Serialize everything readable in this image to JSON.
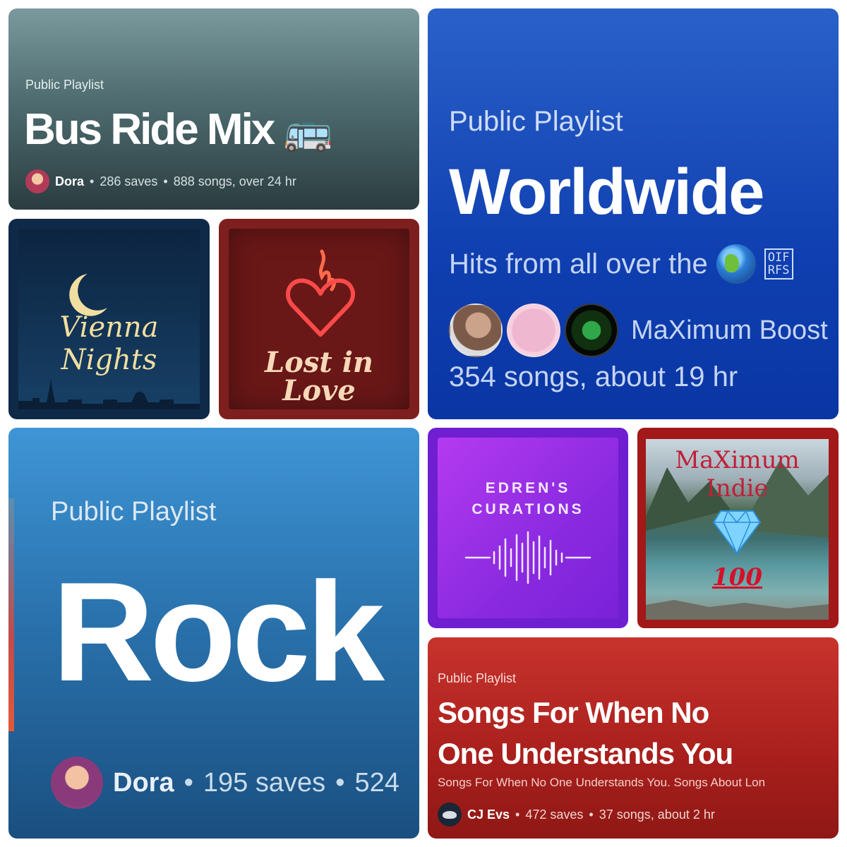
{
  "tiles": {
    "bus": {
      "label": "Public Playlist",
      "title": "Bus Ride Mix",
      "emoji": "🚌",
      "owner": "Dora",
      "saves": "286 saves",
      "songs": "888 songs, over 24 hr"
    },
    "vienna": {
      "line1": "Vienna",
      "line2": "Nights"
    },
    "lost": {
      "line1": "Lost in",
      "line2": "Love"
    },
    "worldwide": {
      "label": "Public Playlist",
      "title": "Worldwide",
      "description": "Hits from all over the",
      "code": "OIF\nRFS",
      "owner": "MaXimum Boost",
      "stats": "354 songs, about 19 hr"
    },
    "rock": {
      "label": "Public Playlist",
      "title": "Rock",
      "owner": "Dora",
      "saves": "195 saves",
      "songs": "524"
    },
    "edren": {
      "line1": "EDREN'S",
      "line2": "CURATIONS"
    },
    "indie": {
      "line1": "MaXimum",
      "line2": "Indie",
      "badge": "100"
    },
    "songs": {
      "label": "Public Playlist",
      "title_line1": "Songs For When No",
      "title_line2": "One Understands You",
      "description": "Songs For When No One Understands You. Songs About Lon",
      "owner": "CJ Evs",
      "saves": "472 saves",
      "songs": "37 songs, about 2 hr"
    }
  },
  "separator": "•",
  "colors": {
    "worldwide_bg": "#1446b8",
    "rock_bg": "#2a73ae",
    "songs_bg": "#a81f1c",
    "edren_bg": "#8a2ae0"
  }
}
